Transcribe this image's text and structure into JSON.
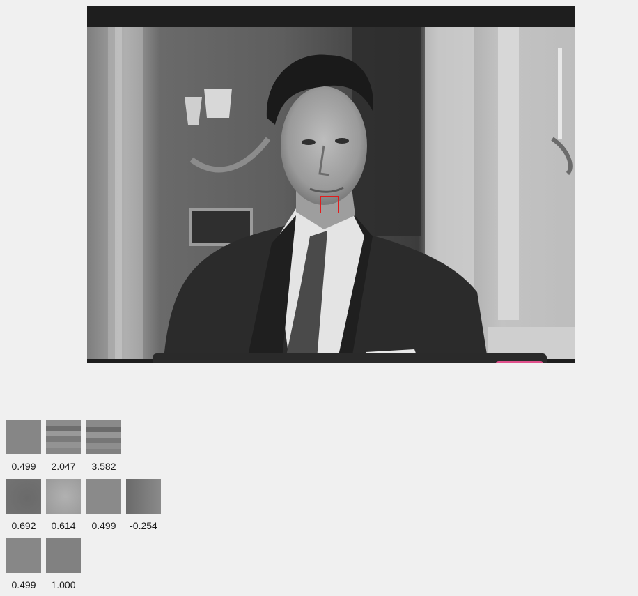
{
  "video": {
    "roi_color": "#e21c1c",
    "accent_color": "#e0508c"
  },
  "patches": {
    "row1": [
      {
        "value": "0.499",
        "shade": "#868686"
      },
      {
        "value": "2.047",
        "shade": "stripes"
      },
      {
        "value": "3.582",
        "shade": "stripes2"
      }
    ],
    "row2": [
      {
        "value": "0.692",
        "shade": "#6f6f6f"
      },
      {
        "value": "0.614",
        "shade": "#a4a4a4"
      },
      {
        "value": "0.499",
        "shade": "#8a8a8a"
      },
      {
        "value": "-0.254",
        "shade": "#7a7a7a"
      }
    ],
    "row3": [
      {
        "value": "0.499",
        "shade": "#878787"
      },
      {
        "value": "1.000",
        "shade": "#818181"
      }
    ]
  }
}
